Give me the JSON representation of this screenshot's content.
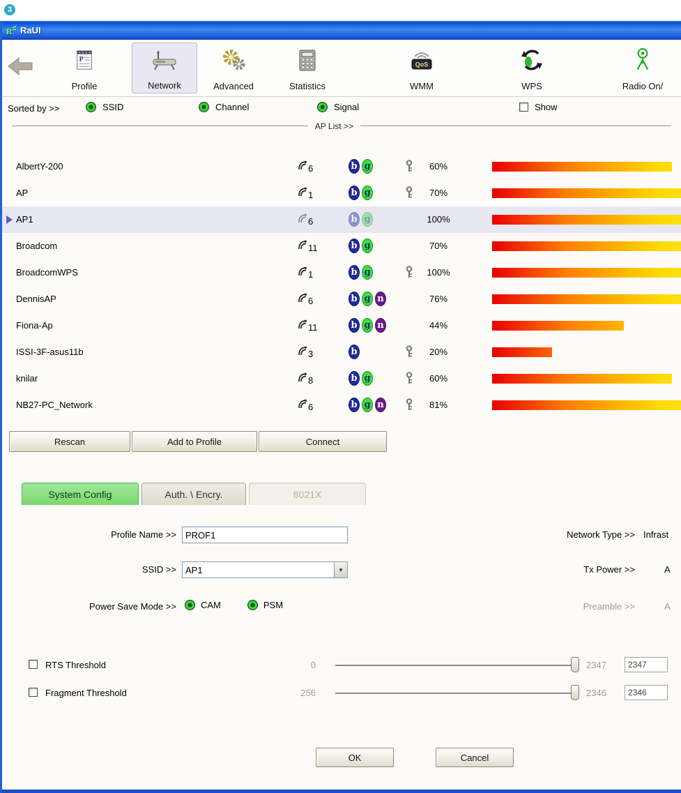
{
  "badge": "3",
  "window": {
    "title": "RaUI"
  },
  "colors": {
    "titlebar_blue": "#1c5ad6",
    "active_tab_green": "#7cd96e",
    "mode_b_navy": "#1f2c9c",
    "mode_g_green": "#3ce03c",
    "mode_n_purple": "#6a1b8a",
    "signal_bar_gradient": [
      "#e80000",
      "#ff8000",
      "#ffd800",
      "#ffff60"
    ]
  },
  "toolbar": {
    "items": [
      {
        "label": "Profile"
      },
      {
        "label": "Network",
        "active": true
      },
      {
        "label": "Advanced"
      },
      {
        "label": "Statistics"
      },
      {
        "label": "WMM",
        "icon_text": "QoS"
      },
      {
        "label": "WPS"
      },
      {
        "label": "Radio On/"
      }
    ]
  },
  "sort_bar": {
    "label": "Sorted by >>",
    "options": [
      "SSID",
      "Channel",
      "Signal"
    ],
    "show_checkbox_label": "Show"
  },
  "ap_list": {
    "divider_label": "AP List >>",
    "rows": [
      {
        "ssid": "AlbertY-200",
        "channel": 6,
        "modes": [
          "b",
          "g"
        ],
        "secured": true,
        "signal": "60%",
        "pct": 60,
        "selected": false,
        "faded": false
      },
      {
        "ssid": "AP",
        "channel": 1,
        "modes": [
          "b",
          "g"
        ],
        "secured": true,
        "signal": "70%",
        "pct": 70,
        "selected": false,
        "faded": false
      },
      {
        "ssid": "AP1",
        "channel": 6,
        "modes": [
          "b",
          "g"
        ],
        "secured": false,
        "signal": "100%",
        "pct": 100,
        "selected": true,
        "faded": true
      },
      {
        "ssid": "Broadcom",
        "channel": 11,
        "modes": [
          "b",
          "g"
        ],
        "secured": false,
        "signal": "70%",
        "pct": 70,
        "selected": false,
        "faded": false
      },
      {
        "ssid": "BroadcomWPS",
        "channel": 1,
        "modes": [
          "b",
          "g"
        ],
        "secured": true,
        "signal": "100%",
        "pct": 100,
        "selected": false,
        "faded": false
      },
      {
        "ssid": "DennisAP",
        "channel": 6,
        "modes": [
          "b",
          "g",
          "n"
        ],
        "secured": false,
        "signal": "76%",
        "pct": 76,
        "selected": false,
        "faded": false
      },
      {
        "ssid": "Fiona-Ap",
        "channel": 11,
        "modes": [
          "b",
          "g",
          "n"
        ],
        "secured": false,
        "signal": "44%",
        "pct": 44,
        "selected": false,
        "faded": false
      },
      {
        "ssid": "ISSI-3F-asus11b",
        "channel": 3,
        "modes": [
          "b"
        ],
        "secured": true,
        "signal": "20%",
        "pct": 20,
        "selected": false,
        "faded": false
      },
      {
        "ssid": "knilar",
        "channel": 8,
        "modes": [
          "b",
          "g"
        ],
        "secured": true,
        "signal": "60%",
        "pct": 60,
        "selected": false,
        "faded": false
      },
      {
        "ssid": "NB27-PC_Network",
        "channel": 6,
        "modes": [
          "b",
          "g",
          "n"
        ],
        "secured": true,
        "signal": "81%",
        "pct": 81,
        "selected": false,
        "faded": false
      }
    ]
  },
  "actions": {
    "rescan": "Rescan",
    "add_to_profile": "Add to Profile",
    "connect": "Connect"
  },
  "tabs": [
    {
      "label": "System Config",
      "state": "active"
    },
    {
      "label": "Auth. \\ Encry.",
      "state": "normal"
    },
    {
      "label": "8021X",
      "state": "disabled"
    }
  ],
  "form": {
    "profile_name_label": "Profile Name >>",
    "profile_name_value": "PROF1",
    "ssid_label": "SSID >>",
    "ssid_value": "AP1",
    "power_save_label": "Power Save Mode >>",
    "power_save_options": [
      "CAM",
      "PSM"
    ],
    "network_type_label": "Network Type >>",
    "network_type_value": "Infrast",
    "tx_power_label": "Tx Power >>",
    "tx_power_value": "A",
    "preamble_label": "Preamble >>",
    "preamble_value": "A",
    "rts": {
      "label": "RTS Threshold",
      "min": "0",
      "max": "2347",
      "value": "2347"
    },
    "fragment": {
      "label": "Fragment Threshold",
      "min": "256",
      "max": "2346",
      "value": "2346"
    }
  },
  "footer": {
    "ok": "OK",
    "cancel": "Cancel"
  }
}
